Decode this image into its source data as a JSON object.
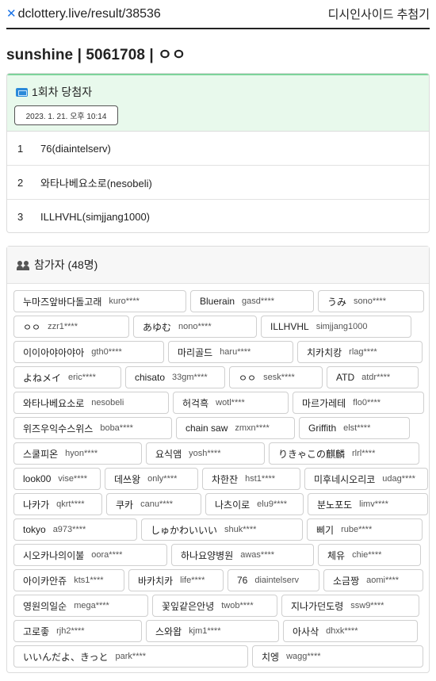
{
  "header": {
    "site": "dclottery.live/result/38536",
    "nav_link": "디시인사이드 추첨기"
  },
  "page_title": "sunshine | 5061708 | ㅇㅇ",
  "winners": {
    "title": "1회차 당첨자",
    "date": "2023. 1. 21. 오후 10:14",
    "items": [
      {
        "rank": "1",
        "name": "76(diaintelserv)"
      },
      {
        "rank": "2",
        "name": "와타나베요소로(nesobeli)"
      },
      {
        "rank": "3",
        "name": "ILLHVHL(simjjang1000)"
      }
    ]
  },
  "participants": {
    "title": "참가자 (48명)",
    "rows": [
      [
        {
          "nick": "누마즈앞바다돌고래",
          "id": "kuro****"
        },
        {
          "nick": "Bluerain",
          "id": "gasd****"
        },
        {
          "nick": "うみ",
          "id": "sono****"
        }
      ],
      [
        {
          "nick": "ㅇㅇ",
          "id": "zzr1****"
        },
        {
          "nick": "あゆむ",
          "id": "nono****"
        },
        {
          "nick": "ILLHVHL",
          "id": "simjjang1000"
        }
      ],
      [
        {
          "nick": "이이아야아야아",
          "id": "gth0****"
        },
        {
          "nick": "마리골드",
          "id": "haru****"
        },
        {
          "nick": "치카치캉",
          "id": "rlag****"
        }
      ],
      [
        {
          "nick": "よねメイ",
          "id": "eric****"
        },
        {
          "nick": "chisato",
          "id": "33gm****"
        },
        {
          "nick": "ㅇㅇ",
          "id": "sesk****"
        },
        {
          "nick": "ATD",
          "id": "atdr****"
        }
      ],
      [
        {
          "nick": "와타나베요소로",
          "id": "nesobeli"
        },
        {
          "nick": "허걱흑",
          "id": "wotl****"
        },
        {
          "nick": "마르가레테",
          "id": "flo0****"
        }
      ],
      [
        {
          "nick": "위즈우익수스위스",
          "id": "boba****"
        },
        {
          "nick": "chain saw",
          "id": "zmxn****"
        },
        {
          "nick": "Griffith",
          "id": "elst****"
        }
      ],
      [
        {
          "nick": "스쿨피온",
          "id": "hyon****"
        },
        {
          "nick": "요식앰",
          "id": "yosh****"
        },
        {
          "nick": "りきゃこの麒麟",
          "id": "rlrl****"
        }
      ],
      [
        {
          "nick": "look00",
          "id": "vise****"
        },
        {
          "nick": "데쓰왕",
          "id": "only****"
        },
        {
          "nick": "차한잔",
          "id": "hst1****"
        },
        {
          "nick": "미후네시오리코",
          "id": "udag****"
        }
      ],
      [
        {
          "nick": "나카가",
          "id": "qkrt****"
        },
        {
          "nick": "쿠카",
          "id": "canu****"
        },
        {
          "nick": "나츠이로",
          "id": "elu9****"
        },
        {
          "nick": "분노포도",
          "id": "limv****"
        }
      ],
      [
        {
          "nick": "tokyo",
          "id": "a973****"
        },
        {
          "nick": "しゅかわいいい",
          "id": "shuk****"
        },
        {
          "nick": "삐기",
          "id": "rube****"
        }
      ],
      [
        {
          "nick": "시오카나의이불",
          "id": "oora****"
        },
        {
          "nick": "하나요양병원",
          "id": "awas****"
        },
        {
          "nick": "체유",
          "id": "chie****"
        }
      ],
      [
        {
          "nick": "아이카안쥬",
          "id": "kts1****"
        },
        {
          "nick": "바카치카",
          "id": "life****"
        },
        {
          "nick": "76",
          "id": "diaintelserv"
        },
        {
          "nick": "소금짱",
          "id": "aomi****"
        }
      ],
      [
        {
          "nick": "영원의일순",
          "id": "mega****"
        },
        {
          "nick": "꽃잎같은안녕",
          "id": "twob****"
        },
        {
          "nick": "지나가던도령",
          "id": "ssw9****"
        }
      ],
      [
        {
          "nick": "고로좋",
          "id": "rjh2****"
        },
        {
          "nick": "스와왑",
          "id": "kjm1****"
        },
        {
          "nick": "아사삭",
          "id": "dhxk****"
        }
      ],
      [
        {
          "nick": "いいんだよ、きっと",
          "id": "park****"
        },
        {
          "nick": "치엥",
          "id": "wagg****"
        }
      ]
    ]
  },
  "colors": {
    "accent": "#1a73e8",
    "winner_header_bg": "#e8f9ec",
    "winner_header_border": "#7dd39a",
    "ticket_icon": "#2b8ad9"
  },
  "icons": {
    "brand": "x-logo-icon",
    "winners": "ticket-icon",
    "participants": "users-icon"
  }
}
